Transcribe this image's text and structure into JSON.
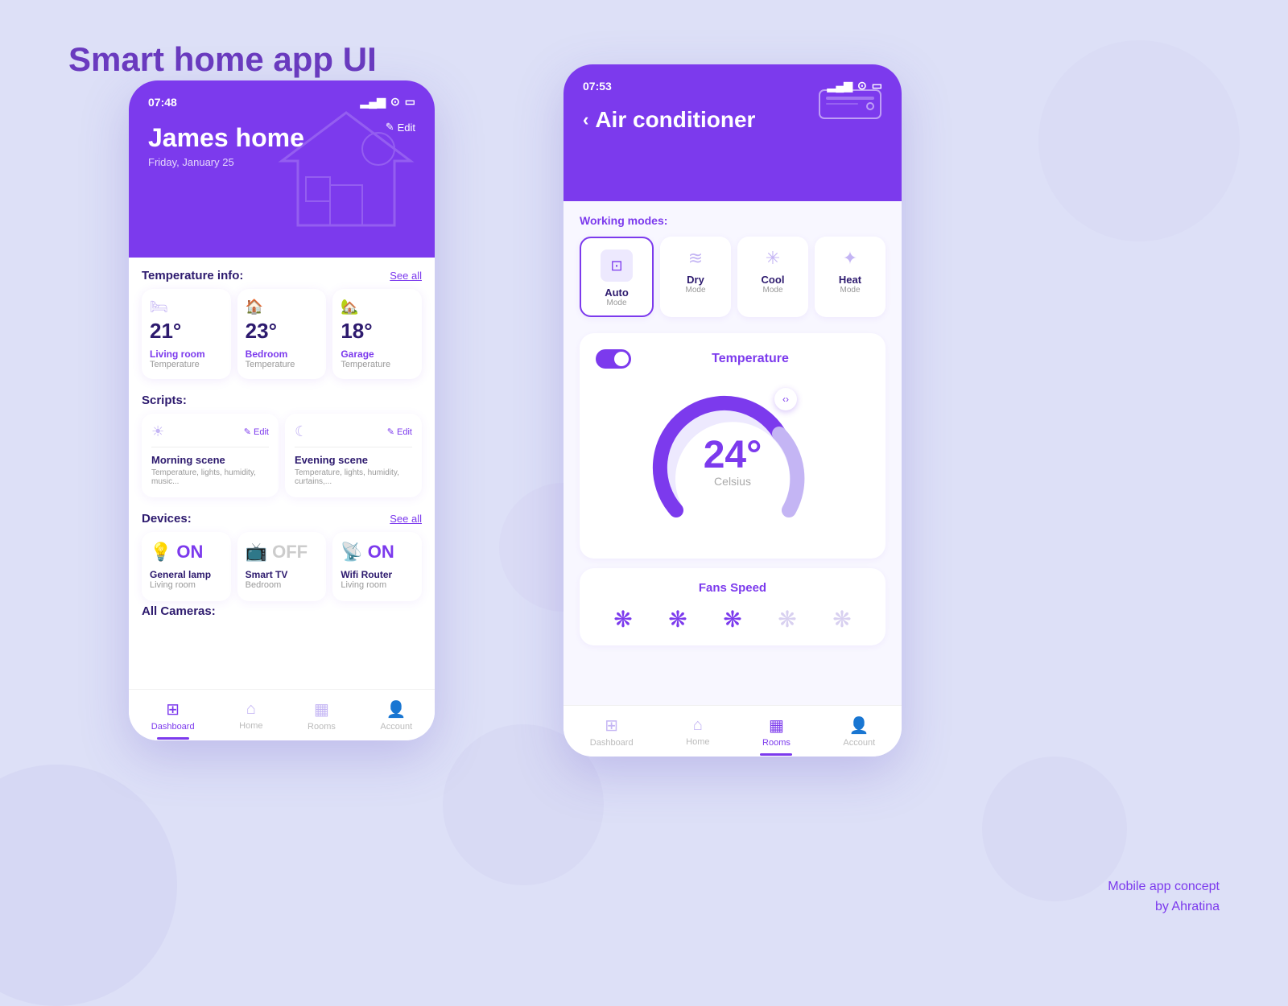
{
  "page": {
    "title": "Smart home app UI",
    "brand": "Mobile app concept\nby Ahratina"
  },
  "phone1": {
    "status_bar": {
      "time": "07:48",
      "signal": "▂▄▆",
      "wifi": "⊙",
      "battery": "▭"
    },
    "header": {
      "home_name": "James home",
      "date": "Friday, January 25",
      "edit_label": "Edit"
    },
    "temperature": {
      "section_title": "Temperature info:",
      "see_all": "See all",
      "cards": [
        {
          "value": "21°",
          "room": "Living room",
          "label": "Temperature"
        },
        {
          "value": "23°",
          "room": "Bedroom",
          "label": "Temperature"
        },
        {
          "value": "18°",
          "room": "Garage",
          "label": "Temperature"
        }
      ]
    },
    "scripts": {
      "section_title": "Scripts:",
      "cards": [
        {
          "icon": "☀",
          "name": "Morning scene",
          "desc": "Temperature, lights, humidity, music...",
          "edit": "✎ Edit"
        },
        {
          "icon": "☾",
          "name": "Evening scene",
          "desc": "Temperature, lights, humidity, curtains,...",
          "edit": "✎ Edit"
        }
      ]
    },
    "devices": {
      "section_title": "Devices:",
      "see_all": "See all",
      "cards": [
        {
          "icon": "💡",
          "status": "ON",
          "name": "General lamp",
          "room": "Living room",
          "is_on": true
        },
        {
          "icon": "📺",
          "status": "OFF",
          "name": "Smart TV",
          "room": "Bedroom",
          "is_on": false
        },
        {
          "icon": "📶",
          "status": "ON",
          "name": "Wifi Router",
          "room": "Living room",
          "is_on": true
        }
      ]
    },
    "cameras": {
      "section_title": "All Cameras:"
    },
    "nav": [
      {
        "label": "Dashboard",
        "active": true
      },
      {
        "label": "Home",
        "active": false
      },
      {
        "label": "Rooms",
        "active": false
      },
      {
        "label": "Account",
        "active": false
      }
    ]
  },
  "phone2": {
    "status_bar": {
      "time": "07:53",
      "signal": "▂▄▆",
      "wifi": "⊙",
      "battery": "▭"
    },
    "header": {
      "back": "‹",
      "title": "Air conditioner"
    },
    "working_modes": {
      "section_title": "Working modes:",
      "modes": [
        {
          "icon": "⊡",
          "name": "Auto",
          "sub": "Mode",
          "active": true
        },
        {
          "icon": "≋",
          "name": "Dry",
          "sub": "Mode",
          "active": false
        },
        {
          "icon": "✳",
          "name": "Cool",
          "sub": "Mode",
          "active": false
        },
        {
          "icon": "✦",
          "name": "Heat",
          "sub": "Mode",
          "active": false
        }
      ]
    },
    "temperature": {
      "title": "Temperature",
      "value": "24°",
      "unit": "Celsius",
      "enabled": true
    },
    "fans_speed": {
      "title": "Fans Speed",
      "levels": [
        {
          "active": true
        },
        {
          "active": true
        },
        {
          "active": true
        },
        {
          "active": false
        },
        {
          "active": false
        }
      ]
    },
    "nav": [
      {
        "label": "Dashboard",
        "active": false
      },
      {
        "label": "Home",
        "active": false
      },
      {
        "label": "Rooms",
        "active": true
      },
      {
        "label": "Account",
        "active": false
      }
    ]
  }
}
